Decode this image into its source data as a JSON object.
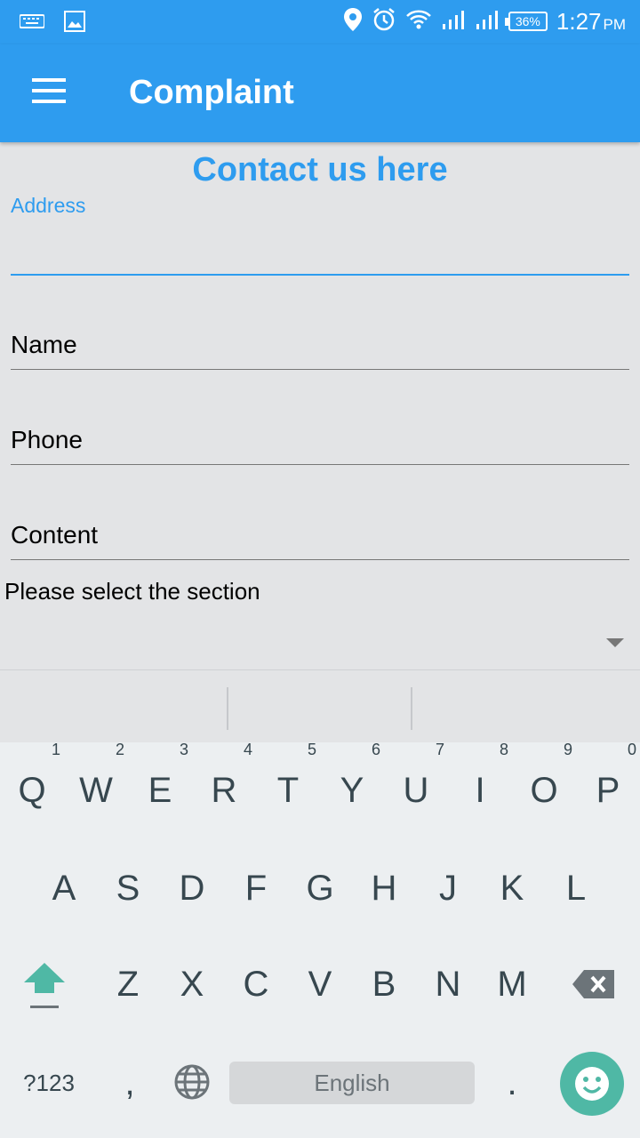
{
  "status_bar": {
    "battery": "36%",
    "time": "1:27",
    "ampm": "PM",
    "icons": [
      "keyboard-icon",
      "image-icon",
      "location-icon",
      "alarm-icon",
      "wifi-icon",
      "signal-icon",
      "signal-icon"
    ]
  },
  "app_bar": {
    "title": "Complaint",
    "menu_icon": "menu-icon"
  },
  "form": {
    "heading": "Contact us here",
    "address_label": "Address",
    "address_value": "",
    "name_placeholder": "Name",
    "phone_placeholder": "Phone",
    "content_placeholder": "Content",
    "section_label": "Please select the section",
    "section_value": ""
  },
  "keyboard": {
    "row1": [
      "Q",
      "W",
      "E",
      "R",
      "T",
      "Y",
      "U",
      "I",
      "O",
      "P"
    ],
    "row1_hints": [
      "1",
      "2",
      "3",
      "4",
      "5",
      "6",
      "7",
      "8",
      "9",
      "0"
    ],
    "row2": [
      "A",
      "S",
      "D",
      "F",
      "G",
      "H",
      "J",
      "K",
      "L"
    ],
    "row3": [
      "Z",
      "X",
      "C",
      "V",
      "B",
      "N",
      "M"
    ],
    "symbols_label": "?123",
    "comma": ",",
    "period": ".",
    "space_label": "English",
    "accent_color": "#4fb8a5"
  },
  "colors": {
    "primary": "#2e9cef",
    "background": "#e3e4e6"
  }
}
